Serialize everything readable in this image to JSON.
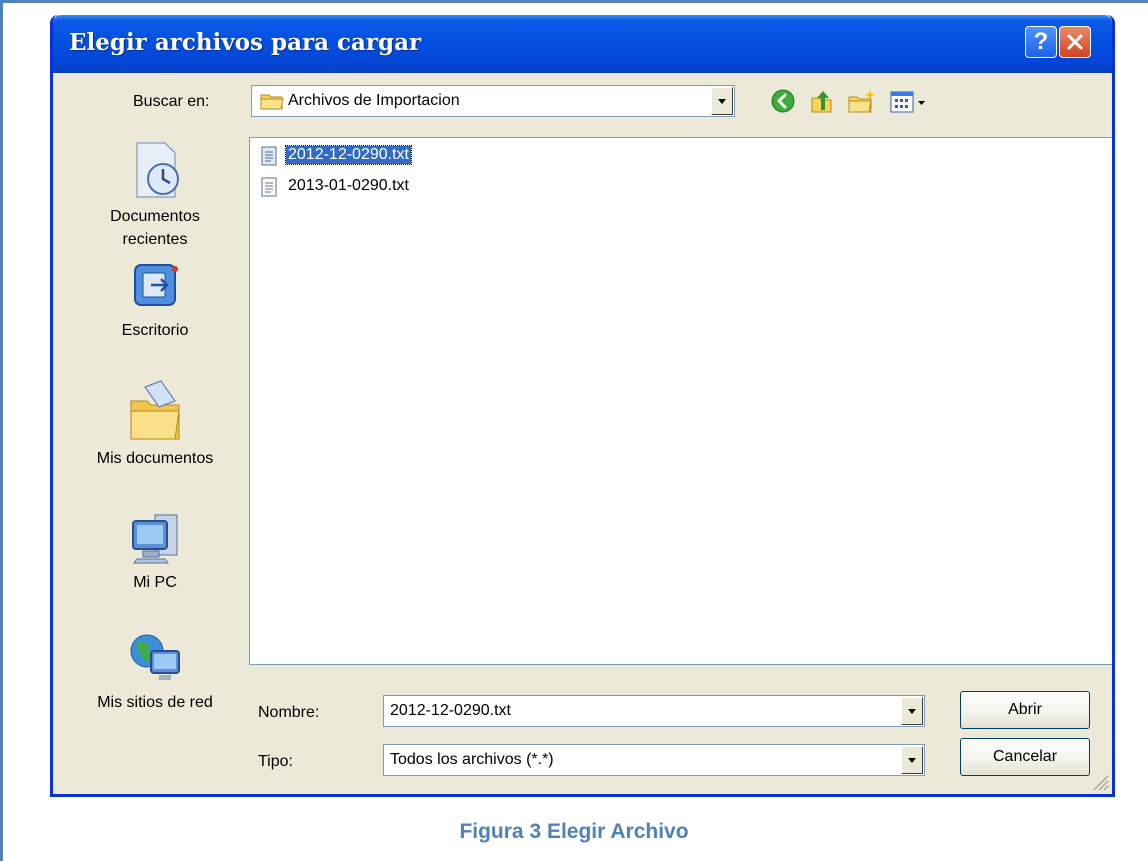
{
  "dialog": {
    "title": "Elegir archivos para cargar",
    "help_label": "?"
  },
  "lookin": {
    "label": "Buscar en:",
    "value": "Archivos de Importacion"
  },
  "toolbar_icons": [
    "back-icon",
    "up-folder-icon",
    "new-folder-icon",
    "view-menu-icon"
  ],
  "places": [
    {
      "label_line1": "Documentos",
      "label_line2": "recientes",
      "icon": "recent-documents-icon"
    },
    {
      "label_line1": "Escritorio",
      "label_line2": "",
      "icon": "desktop-icon"
    },
    {
      "label_line1": "Mis documentos",
      "label_line2": "",
      "icon": "my-documents-icon"
    },
    {
      "label_line1": "Mi PC",
      "label_line2": "",
      "icon": "my-computer-icon"
    },
    {
      "label_line1": "Mis sitios de red",
      "label_line2": "",
      "icon": "network-places-icon"
    }
  ],
  "files": [
    {
      "name": "2012-12-0290.txt",
      "selected": true
    },
    {
      "name": "2013-01-0290.txt",
      "selected": false
    }
  ],
  "filename": {
    "label": "Nombre:",
    "value": "2012-12-0290.txt"
  },
  "filetype": {
    "label": "Tipo:",
    "value": "Todos los archivos (*.*)"
  },
  "buttons": {
    "open": "Abrir",
    "cancel": "Cancelar"
  },
  "caption": "Figura 3 Elegir Archivo",
  "colors": {
    "titlebar": "#0450e0",
    "dialog_bg": "#ece9d8",
    "selection": "#316ac5",
    "caption": "#4f81bd"
  }
}
